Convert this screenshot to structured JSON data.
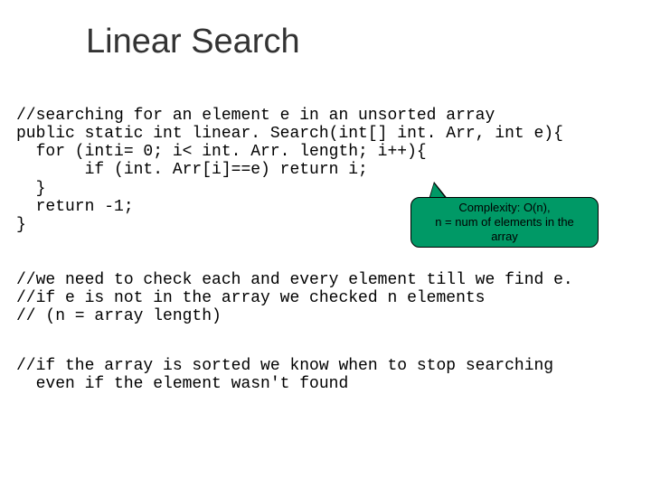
{
  "title": "Linear Search",
  "code": {
    "block1": "//searching for an element e in an unsorted array\npublic static int linear. Search(int[] int. Arr, int e){\n  for (inti= 0; i< int. Arr. length; i++){\n       if (int. Arr[i]==e) return i;\n  }\n  return -1;\n}",
    "block2": "//we need to check each and every element till we find e.\n//if e is not in the array we checked n elements\n// (n = array length)",
    "block3": "//if the array is sorted we know when to stop searching\n  even if the element wasn't found"
  },
  "callout": {
    "line1": "Complexity: O(n),",
    "line2": "n = num of elements in the",
    "line3": "array"
  }
}
